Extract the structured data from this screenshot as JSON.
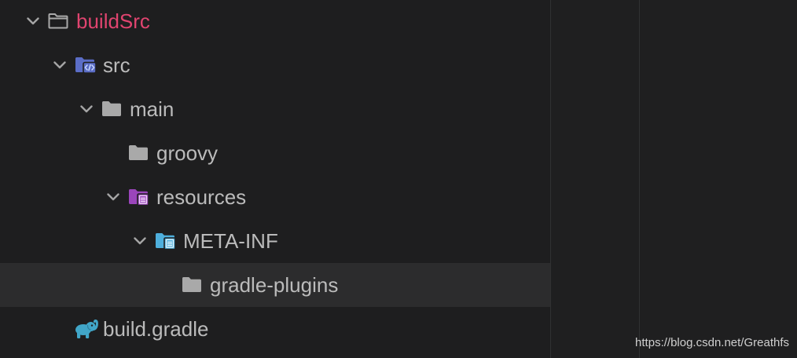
{
  "project_tree": {
    "root": {
      "label": "buildSrc",
      "icon": "folder-outline-icon",
      "expanded": true,
      "children": [
        {
          "label": "src",
          "icon": "source-folder-icon",
          "expanded": true,
          "children": [
            {
              "label": "main",
              "icon": "folder-icon",
              "expanded": true,
              "children": [
                {
                  "label": "groovy",
                  "icon": "folder-icon"
                },
                {
                  "label": "resources",
                  "icon": "resources-folder-icon",
                  "expanded": true,
                  "children": [
                    {
                      "label": "META-INF",
                      "icon": "meta-inf-folder-icon",
                      "expanded": true,
                      "children": [
                        {
                          "label": "gradle-plugins",
                          "icon": "folder-icon",
                          "selected": true
                        }
                      ]
                    }
                  ]
                }
              ]
            }
          ]
        },
        {
          "label": "build.gradle",
          "icon": "gradle-elephant-icon"
        }
      ]
    }
  },
  "watermark": "https://blog.csdn.net/Greathfs",
  "colors": {
    "panel_background": "#1e1e1f",
    "editor_background": "#1f1f20",
    "selection_background": "#2c2c2d",
    "text": "#bbbbbb",
    "module_name": "#e0446f",
    "folder": "#a9a9a9",
    "chevron": "#a5a5a5",
    "source_folder": "#5b6dc6",
    "resources_folder": "#9b45bb",
    "meta_inf_folder": "#4eafdc",
    "gradle_icon": "#41a6c8",
    "watermark": "#cfcfcf"
  }
}
